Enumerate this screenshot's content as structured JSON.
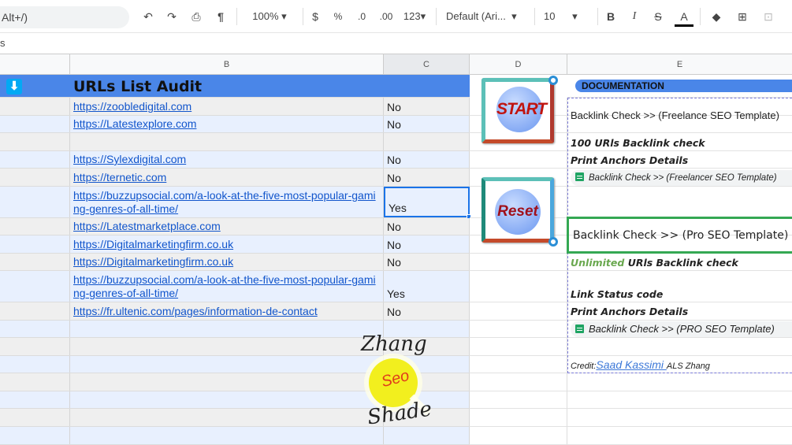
{
  "toolbar": {
    "search": "Alt+/)",
    "zoom": "100%",
    "currency": "$",
    "percent": "%",
    "dec_less": ".0",
    "dec_more": ".00",
    "format": "123",
    "font": "Default (Ari...",
    "size": "10",
    "bold": "B",
    "italic": "I",
    "strike": "S",
    "text_color": "A"
  },
  "formula_bar": {
    "value": "s"
  },
  "columns": [
    "B",
    "C",
    "D",
    "E"
  ],
  "sheet": {
    "title": "URLs List Audit",
    "rows": [
      {
        "b": "https://zoobledigital.com",
        "c": "No"
      },
      {
        "b": "https://Latestexplore.com",
        "c": "No"
      },
      {
        "b": "",
        "c": ""
      },
      {
        "b": "https://Sylexdigital.com",
        "c": "No"
      },
      {
        "b": "https://ternetic.com",
        "c": "No"
      },
      {
        "b": "https://buzzupsocial.com/a-look-at-the-five-most-popular-gaming-genres-of-all-time/",
        "c": "Yes"
      },
      {
        "b": "https://Latestmarketplace.com",
        "c": "No"
      },
      {
        "b": "https://Digitalmarketingfirm.co.uk",
        "c": "No"
      },
      {
        "b": "https://Digitalmarketingfirm.co.uk",
        "c": "No"
      },
      {
        "b": "https://buzzupsocial.com/a-look-at-the-five-most-popular-gaming-genres-of-all-time/",
        "c": "Yes"
      },
      {
        "b": "https://fr.ultenic.com/pages/information-de-contact",
        "c": "No"
      },
      {
        "b": "",
        "c": ""
      },
      {
        "b": "",
        "c": ""
      },
      {
        "b": "",
        "c": ""
      },
      {
        "b": "",
        "c": ""
      },
      {
        "b": "",
        "c": ""
      },
      {
        "b": "",
        "c": ""
      },
      {
        "b": "",
        "c": ""
      }
    ]
  },
  "buttons": {
    "start": "START",
    "reset": "Reset"
  },
  "docs": {
    "header": "DOCUMENTATION",
    "freelance_title": "Backlink Check >> (Freelance SEO Template)",
    "freelance_limit": "100 URls Backlink check",
    "freelance_anchors": "Print Anchors Details",
    "freelance_chip": "Backlink Check >> (Freelancer SEO Template)",
    "pro_title": "Backlink Check >> (Pro SEO Template)",
    "pro_unlimited": "Unlimited",
    "pro_limit": " URls Backlink check",
    "pro_status": "Link Status code",
    "pro_anchors": "Print Anchors Details",
    "pro_chip": "Backlink Check >> (PRO SEO Template)",
    "credit_label": "Credit:",
    "credit_link": "Saad Kassimi ",
    "credit_suffix": "ALS Zhang"
  },
  "watermark": {
    "line1": "Zhang",
    "line2": "Seo",
    "line3": "Shade"
  },
  "colors": {
    "header_blue": "#4a86e8",
    "band_grey": "#efefef",
    "band_blue": "#e8f0fe",
    "link": "#1155cc",
    "green": "#34a853"
  }
}
